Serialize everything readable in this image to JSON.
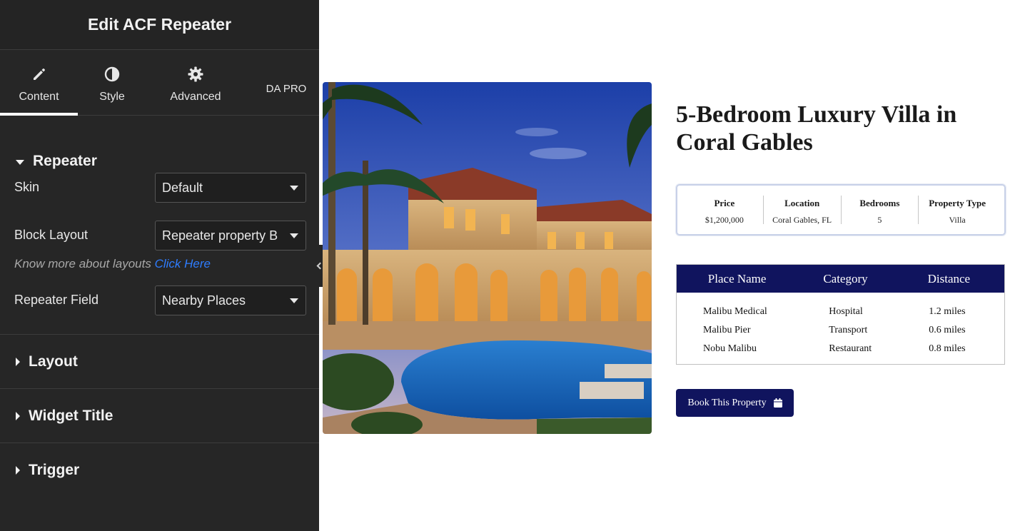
{
  "panel": {
    "title": "Edit ACF Repeater",
    "tabs": [
      {
        "label": "Content",
        "icon": "pencil-icon",
        "active": true
      },
      {
        "label": "Style",
        "icon": "half-circle-icon",
        "active": false
      },
      {
        "label": "Advanced",
        "icon": "gear-icon",
        "active": false
      },
      {
        "label": "DA PRO",
        "icon": "",
        "active": false
      }
    ],
    "repeater_section": {
      "label": "Repeater",
      "skin": {
        "label": "Skin",
        "value": "Default"
      },
      "block_layout": {
        "label": "Block Layout",
        "value": "Repeater property B"
      },
      "hint": {
        "text": "Know more about layouts",
        "link": "Click Here"
      },
      "repeater_field": {
        "label": "Repeater Field",
        "value": "Nearby Places"
      }
    },
    "sections": [
      {
        "label": "Layout"
      },
      {
        "label": "Widget Title"
      },
      {
        "label": "Trigger"
      }
    ]
  },
  "preview": {
    "title": "5-Bedroom Luxury Villa in Coral Gables",
    "specs": [
      {
        "label": "Price",
        "value": "$1,200,000"
      },
      {
        "label": "Location",
        "value": "Coral Gables, FL"
      },
      {
        "label": "Bedrooms",
        "value": "5"
      },
      {
        "label": "Property Type",
        "value": "Villa"
      }
    ],
    "places_table": {
      "headers": [
        "Place Name",
        "Category",
        "Distance"
      ],
      "rows": [
        [
          "Malibu Medical",
          "Hospital",
          "1.2 miles"
        ],
        [
          "Malibu Pier",
          "Transport",
          "0.6 miles"
        ],
        [
          "Nobu Malibu",
          "Restaurant",
          "0.8 miles"
        ]
      ]
    },
    "book_button": {
      "label": "Book This Property",
      "icon": "calendar-icon"
    }
  },
  "colors": {
    "panel_bg": "#262626",
    "accent_navy": "#10145e",
    "link_blue": "#2f7dff"
  }
}
